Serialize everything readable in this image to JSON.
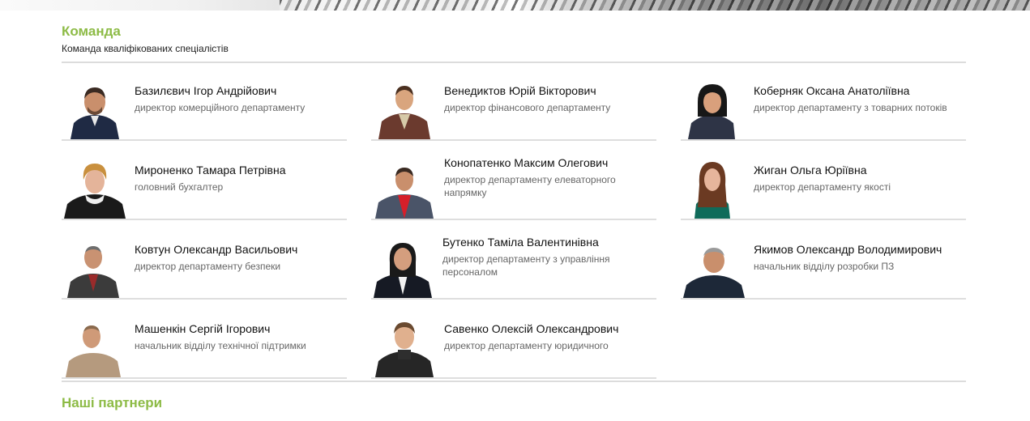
{
  "team": {
    "title": "Команда",
    "subtitle": "Команда кваліфікованих спеціалістів",
    "members": [
      {
        "name": "Базилєвич Ігор Андрійович",
        "role": "директор комерційного департаменту"
      },
      {
        "name": "Венедиктов Юрій Вікторович",
        "role": "директор фінансового департаменту"
      },
      {
        "name": "Коберняк Оксана Анатоліївна",
        "role": "директор департаменту з товарних потоків"
      },
      {
        "name": "Мироненко Тамара Петрівна",
        "role": "головний бухгалтер"
      },
      {
        "name": "Конопатенко Максим Олегович",
        "role": "директор департаменту елеваторного напрямку"
      },
      {
        "name": "Жиган Ольга Юріївна",
        "role": "директор департаменту якості"
      },
      {
        "name": "Ковтун Олександр Васильович",
        "role": "директор департаменту безпеки"
      },
      {
        "name": "Бутенко Таміла Валентинівна",
        "role": "директор департаменту з управління персоналом"
      },
      {
        "name": "Якимов Олександр Володимирович",
        "role": "начальник відділу розробки ПЗ"
      },
      {
        "name": "Машенкін Сергій Ігорович",
        "role": "начальник відділу технічної підтримки"
      },
      {
        "name": "Савенко Олексій Олександрович",
        "role": "директор департаменту юридичного"
      }
    ]
  },
  "partners": {
    "title": "Наші партнери"
  },
  "colors": {
    "accent": "#8dbb46",
    "divider": "#dcdcdc"
  }
}
